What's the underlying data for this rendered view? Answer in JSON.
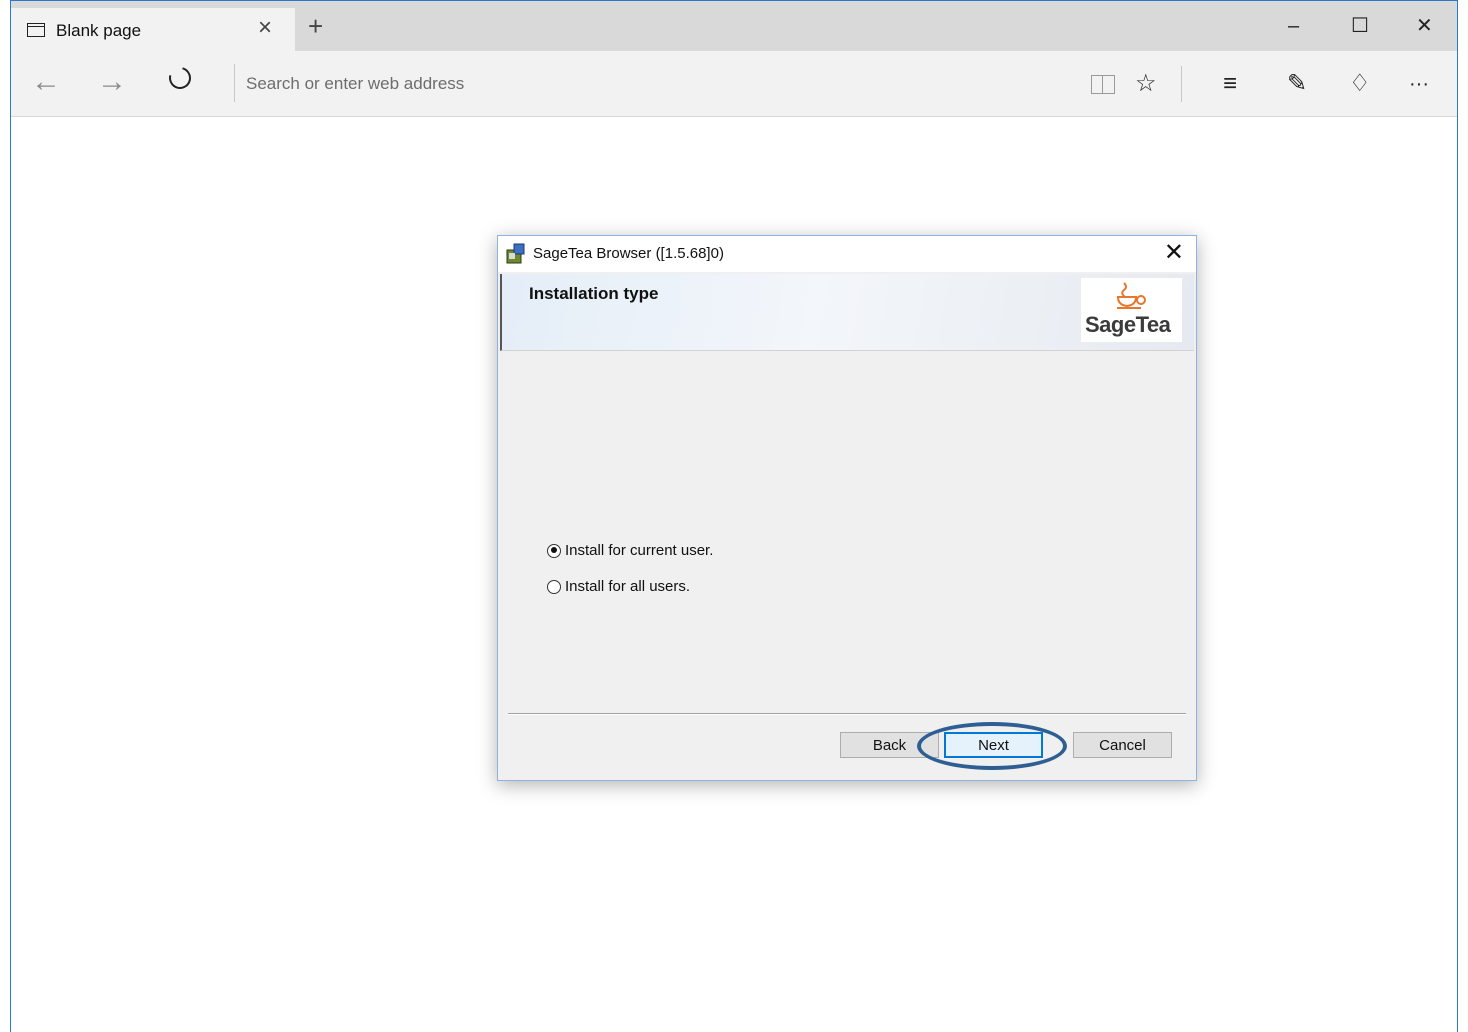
{
  "browser": {
    "tab": {
      "title": "Blank page",
      "icon": "page-icon"
    },
    "new_tab_icon": "plus-icon",
    "window_controls": {
      "minimize": "–",
      "maximize": "☐",
      "close": "✕"
    },
    "address_bar": {
      "placeholder": "Search or enter web address",
      "value": ""
    },
    "nav": {
      "back": "←",
      "forward": "→"
    },
    "tools": {
      "favorite": "☆",
      "hub": "≡",
      "note": "✎",
      "share": "♢",
      "more": "···"
    }
  },
  "dialog": {
    "title": "SageTea Browser ([1.5.68]0)",
    "close_glyph": "✕",
    "banner_title": "Installation type",
    "logo_text": "SageTea",
    "options": [
      {
        "label": "Install for current user.",
        "selected": true
      },
      {
        "label": "Install for all users.",
        "selected": false
      }
    ],
    "buttons": {
      "back": "Back",
      "next": "Next",
      "cancel": "Cancel"
    }
  },
  "colors": {
    "window_border": "#2b79c8",
    "highlight_ring": "#2e5f93",
    "logo_orange": "#e8772e",
    "default_button_border": "#0078d7"
  }
}
